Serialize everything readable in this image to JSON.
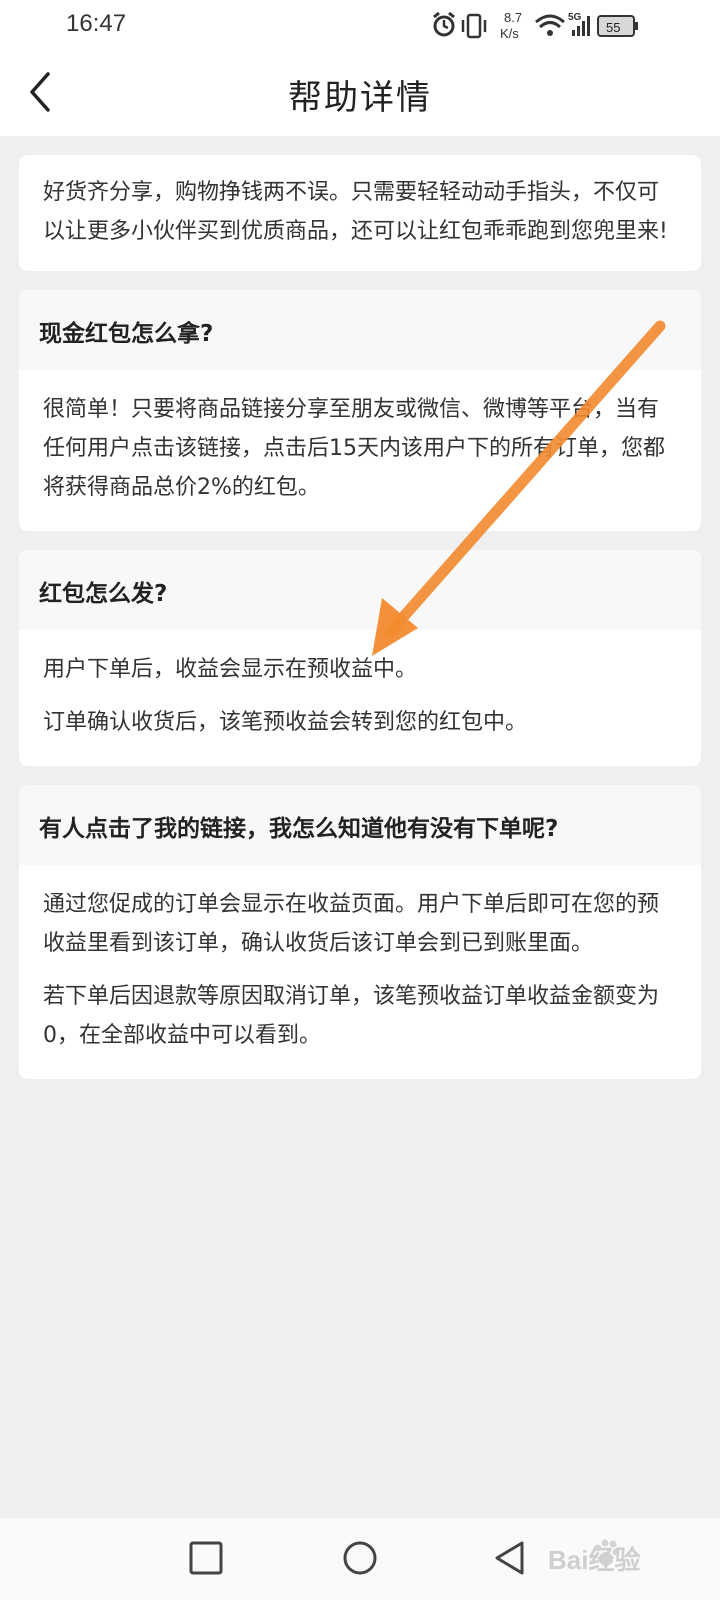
{
  "status_bar": {
    "time": "16:47",
    "net_speed_value": "8.7",
    "net_speed_unit": "K/s",
    "signal_type": "5G",
    "battery": "55",
    "icons": [
      "alarm-icon",
      "vibrate-icon",
      "wifi-icon",
      "signal-icon",
      "battery-icon"
    ]
  },
  "header": {
    "title": "帮助详情",
    "back_icon": "chevron-left-icon"
  },
  "intro": "好货齐分享，购物挣钱两不误。只需要轻轻动动手指头，不仅可以让更多小伙伴买到优质商品，还可以让红包乖乖跑到您兜里来!",
  "faq": [
    {
      "question": "现金红包怎么拿?",
      "answers": [
        "很简单！只要将商品链接分享至朋友或微信、微博等平台，当有任何用户点击该链接，点击后15天内该用户下的所有订单，您都将获得商品总价2%的红包。"
      ]
    },
    {
      "question": "红包怎么发?",
      "answers": [
        "用户下单后，收益会显示在预收益中。",
        "订单确认收货后，该笔预收益会转到您的红包中。"
      ]
    },
    {
      "question": "有人点击了我的链接，我怎么知道他有没有下单呢?",
      "answers": [
        "通过您促成的订单会显示在收益页面。用户下单后即可在您的预收益里看到该订单，确认收货后该订单会到已到账里面。",
        "若下单后因退款等原因取消订单，该笔预收益订单收益金额变为0，在全部收益中可以看到。"
      ]
    }
  ],
  "annotation": {
    "type": "arrow",
    "color": "#f28a2e"
  },
  "bottom_nav": {
    "items": [
      "recent-apps-icon",
      "home-icon",
      "back-icon"
    ]
  },
  "watermark": {
    "text": "Bai经验",
    "icon": "paw-icon"
  }
}
